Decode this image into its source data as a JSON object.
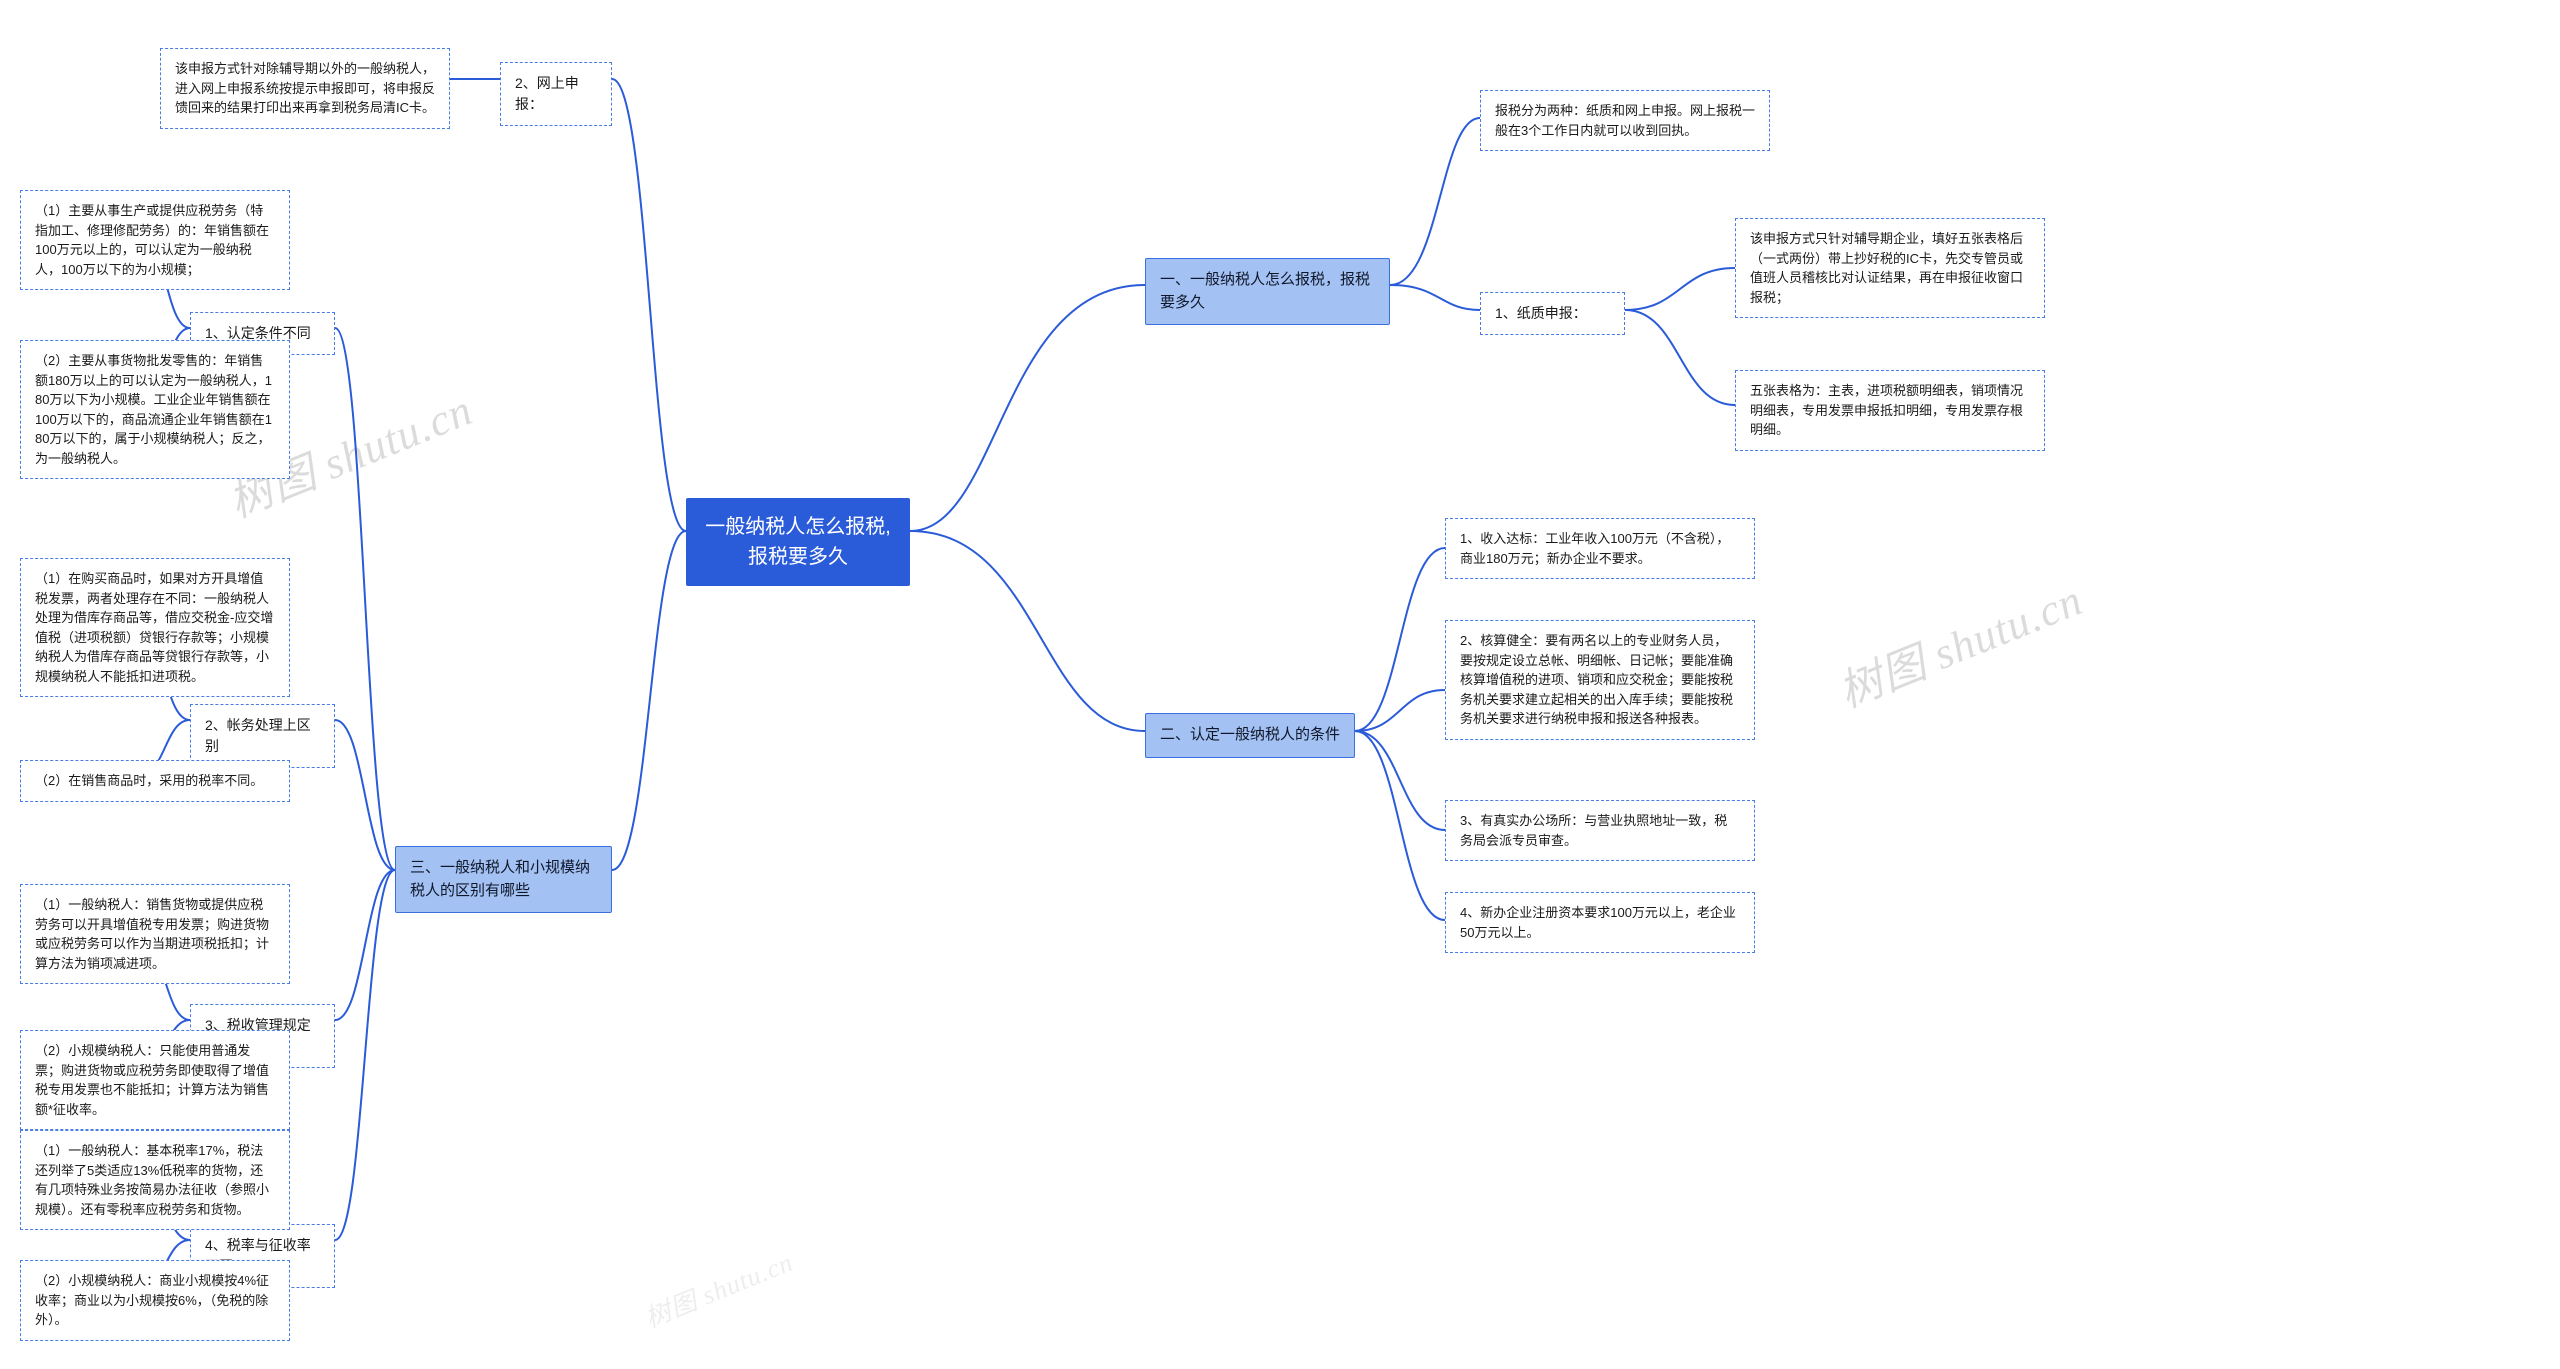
{
  "watermark": "树图 shutu.cn",
  "root": {
    "title": "一般纳税人怎么报税,报税要多久"
  },
  "branches": {
    "b1": {
      "title": "一、一般纳税人怎么报税，报税要多久",
      "subs": {
        "s1": {
          "label": "1、纸质申报：",
          "leaves": {
            "l1": "报税分为两种：纸质和网上申报。网上报税一般在3个工作日内就可以收到回执。",
            "l2": "该申报方式只针对辅导期企业，填好五张表格后（一式两份）带上抄好税的IC卡，先交专管员或值班人员稽核比对认证结果，再在申报征收窗口报税；",
            "l3": "五张表格为：主表，进项税额明细表，销项情况明细表，专用发票申报抵扣明细，专用发票存根明细。"
          }
        },
        "s2": {
          "label": "2、网上申报：",
          "leaves": {
            "l1": "该申报方式针对除辅导期以外的一般纳税人，进入网上申报系统按提示申报即可，将申报反馈回来的结果打印出来再拿到税务局清IC卡。"
          }
        }
      }
    },
    "b2": {
      "title": "二、认定一般纳税人的条件",
      "leaves": {
        "l1": "1、收入达标：工业年收入100万元（不含税），商业180万元；新办企业不要求。",
        "l2": "2、核算健全：要有两名以上的专业财务人员，要按规定设立总帐、明细帐、日记帐；要能准确核算增值税的进项、销项和应交税金；要能按税务机关要求建立起相关的出入库手续；要能按税务机关要求进行纳税申报和报送各种报表。",
        "l3": "3、有真实办公场所：与营业执照地址一致，税务局会派专员审查。",
        "l4": "4、新办企业注册资本要求100万元以上，老企业50万元以上。"
      }
    },
    "b3": {
      "title": "三、一般纳税人和小规模纳税人的区别有哪些",
      "subs": {
        "s1": {
          "label": "1、认定条件不同",
          "leaves": {
            "l1": "（1）主要从事生产或提供应税劳务（特指加工、修理修配劳务）的：年销售额在100万元以上的，可以认定为一般纳税人，100万以下的为小规模；",
            "l2": "（2）主要从事货物批发零售的：年销售额180万以上的可以认定为一般纳税人，180万以下为小规模。工业企业年销售额在100万以下的，商品流通企业年销售额在180万以下的，属于小规模纳税人；反之，为一般纳税人。"
          }
        },
        "s2": {
          "label": "2、帐务处理上区别",
          "leaves": {
            "l1": "（1）在购买商品时，如果对方开具增值税发票，两者处理存在不同：一般纳税人处理为借库存商品等，借应交税金-应交增值税（进项税额）贷银行存款等；小规模纳税人为借库存商品等贷银行存款等，小规模纳税人不能抵扣进项税。",
            "l2": "（2）在销售商品时，采用的税率不同。"
          }
        },
        "s3": {
          "label": "3、税收管理规定的区别",
          "leaves": {
            "l1": "（1）一般纳税人：销售货物或提供应税劳务可以开具增值税专用发票；购进货物或应税劳务可以作为当期进项税抵扣；计算方法为销项减进项。",
            "l2": "（2）小规模纳税人：只能使用普通发票；购进货物或应税劳务即使取得了增值税专用发票也不能抵扣；计算方法为销售额*征收率。"
          }
        },
        "s4": {
          "label": "4、税率与征收率不同",
          "leaves": {
            "l1": "（1）一般纳税人：基本税率17%，税法还列举了5类适应13%低税率的货物，还有几项特殊业务按简易办法征收（参照小规模）。还有零税率应税劳务和货物。",
            "l2": "（2）小规模纳税人：商业小规模按4%征收率；商业以为小规模按6%，（免税的除外）。"
          }
        }
      }
    }
  }
}
